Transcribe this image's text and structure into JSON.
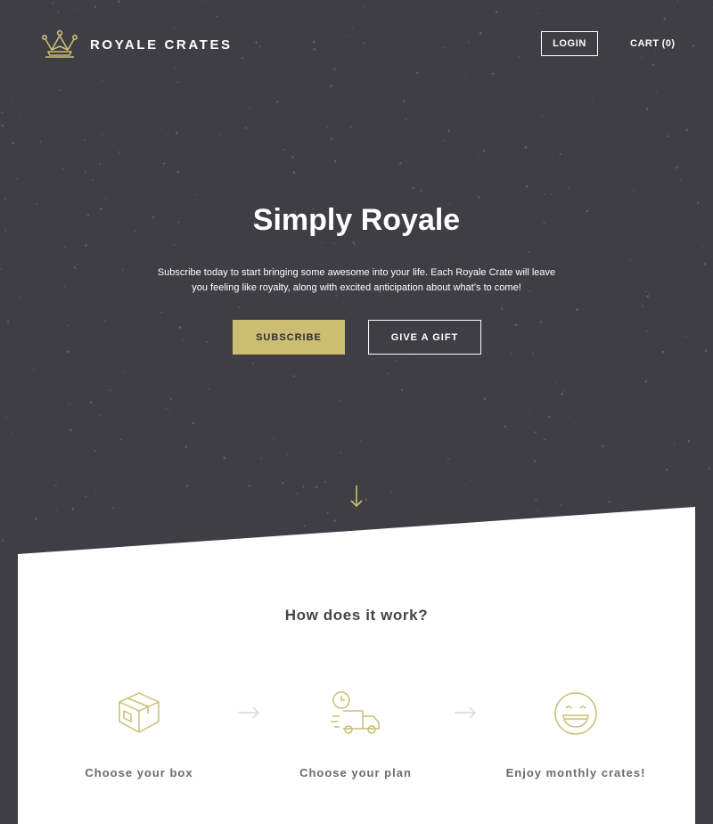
{
  "header": {
    "brand": "ROYALE CRATES",
    "login_label": "LOGIN",
    "cart_label": "CART",
    "cart_count": "(0)",
    "logo_icon": "crown-icon"
  },
  "hero": {
    "title": "Simply Royale",
    "subtitle": "Subscribe today to start bringing some awesome into your life. Each Royale Crate will leave you feeling like royalty, along with excited anticipation about what’s to come!",
    "subscribe_label": "SUBSCRIBE",
    "gift_label": "GIVE A GIFT",
    "scroll_icon": "arrow-down-icon"
  },
  "how": {
    "title": "How does it work?",
    "steps": [
      {
        "icon": "box-icon",
        "label": "Choose your box"
      },
      {
        "icon": "delivery-truck-icon",
        "label": "Choose your plan"
      },
      {
        "icon": "smiley-icon",
        "label": "Enjoy monthly crates!"
      }
    ]
  },
  "colors": {
    "background": "#3f3e44",
    "accent": "#cbbd72",
    "panel": "#ffffff",
    "step_text": "#6b6a70"
  }
}
